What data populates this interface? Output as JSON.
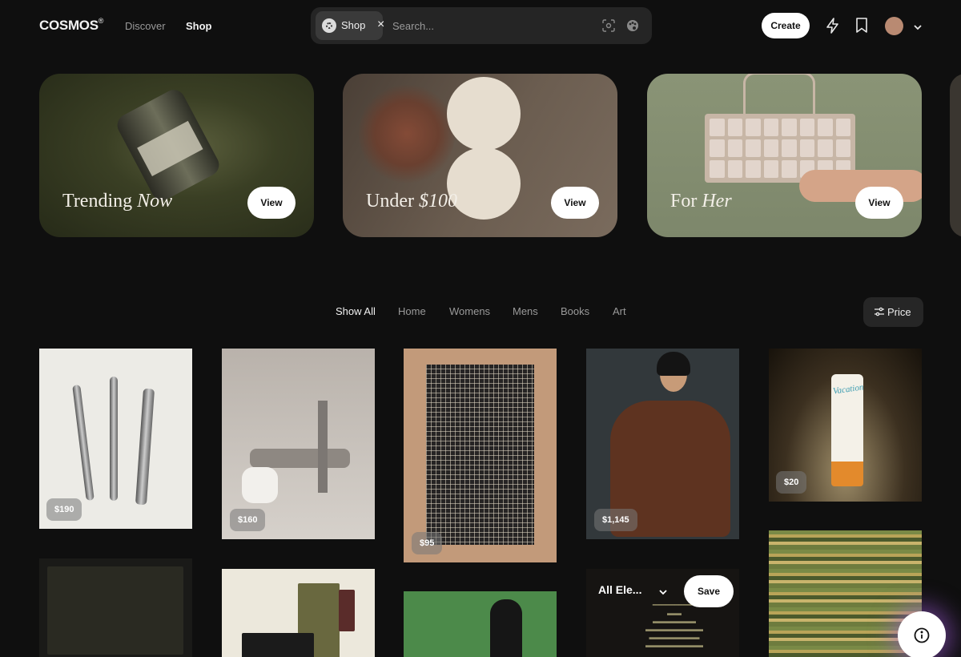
{
  "header": {
    "logo": "COSMOS",
    "logo_mark": "®",
    "nav": [
      {
        "label": "Discover",
        "active": false
      },
      {
        "label": "Shop",
        "active": true
      }
    ],
    "search": {
      "chip_label": "Shop",
      "placeholder": "Search..."
    },
    "create_label": "Create",
    "icons": [
      "lens-search-icon",
      "palette-icon",
      "bolt-icon",
      "bookmark-icon",
      "avatar",
      "chevron-down-icon"
    ]
  },
  "hero_cards": [
    {
      "title_plain": "Trending ",
      "title_italic": "Now",
      "button": "View"
    },
    {
      "title_plain": "Under ",
      "title_italic": "$100",
      "button": "View"
    },
    {
      "title_plain": "For ",
      "title_italic": "Her",
      "button": "View"
    }
  ],
  "filters": {
    "tabs": [
      {
        "label": "Show All",
        "active": true
      },
      {
        "label": "Home",
        "active": false
      },
      {
        "label": "Womens",
        "active": false
      },
      {
        "label": "Mens",
        "active": false
      },
      {
        "label": "Books",
        "active": false
      },
      {
        "label": "Art",
        "active": false
      }
    ],
    "price_label": "Price"
  },
  "products": [
    {
      "name": "cutlery-set",
      "price": "$190"
    },
    {
      "name": "metal-sculpture",
      "price": "$160"
    },
    {
      "name": "woven-rug",
      "price": "$95"
    },
    {
      "name": "brown-coat",
      "price": "$1,145"
    },
    {
      "name": "vacation-sunscreen",
      "price": "$20"
    }
  ],
  "product_tube_text": "Vacation",
  "save_overlay": {
    "collection": "All Ele...",
    "save_label": "Save"
  },
  "colors": {
    "background": "#0f0f0f",
    "surface": "#252525",
    "accent_glow": "#a05adc"
  }
}
